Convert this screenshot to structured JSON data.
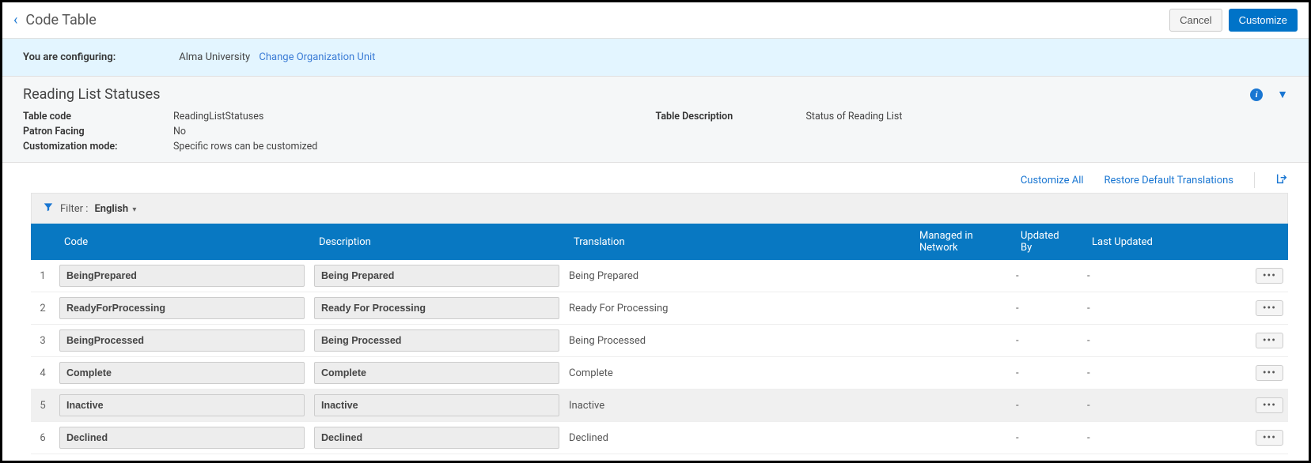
{
  "header": {
    "title": "Code Table",
    "cancel_label": "Cancel",
    "customize_label": "Customize"
  },
  "config": {
    "label": "You are configuring:",
    "org": "Alma University",
    "change_link": "Change Organization Unit"
  },
  "section": {
    "title": "Reading List Statuses"
  },
  "meta": {
    "table_code_label": "Table code",
    "table_code_value": "ReadingListStatuses",
    "patron_facing_label": "Patron Facing",
    "patron_facing_value": "No",
    "customization_mode_label": "Customization mode:",
    "customization_mode_value": "Specific rows can be customized",
    "table_desc_label": "Table Description",
    "table_desc_value": "Status of Reading List"
  },
  "actions": {
    "customize_all": "Customize All",
    "restore_defaults": "Restore Default Translations"
  },
  "filter": {
    "label": "Filter :",
    "value": "English"
  },
  "columns": {
    "code": "Code",
    "description": "Description",
    "translation": "Translation",
    "managed": "Managed in Network",
    "updated_by": "Updated By",
    "last_updated": "Last Updated"
  },
  "rows": [
    {
      "num": "1",
      "code": "BeingPrepared",
      "description": "Being Prepared",
      "translation": "Being Prepared",
      "managed": "",
      "updated_by": "-",
      "last_updated": "-"
    },
    {
      "num": "2",
      "code": "ReadyForProcessing",
      "description": "Ready For Processing",
      "translation": "Ready For Processing",
      "managed": "",
      "updated_by": "-",
      "last_updated": "-"
    },
    {
      "num": "3",
      "code": "BeingProcessed",
      "description": "Being Processed",
      "translation": "Being Processed",
      "managed": "",
      "updated_by": "-",
      "last_updated": "-"
    },
    {
      "num": "4",
      "code": "Complete",
      "description": "Complete",
      "translation": "Complete",
      "managed": "",
      "updated_by": "-",
      "last_updated": "-"
    },
    {
      "num": "5",
      "code": "Inactive",
      "description": "Inactive",
      "translation": "Inactive",
      "managed": "",
      "updated_by": "-",
      "last_updated": "-"
    },
    {
      "num": "6",
      "code": "Declined",
      "description": "Declined",
      "translation": "Declined",
      "managed": "",
      "updated_by": "-",
      "last_updated": "-"
    }
  ]
}
